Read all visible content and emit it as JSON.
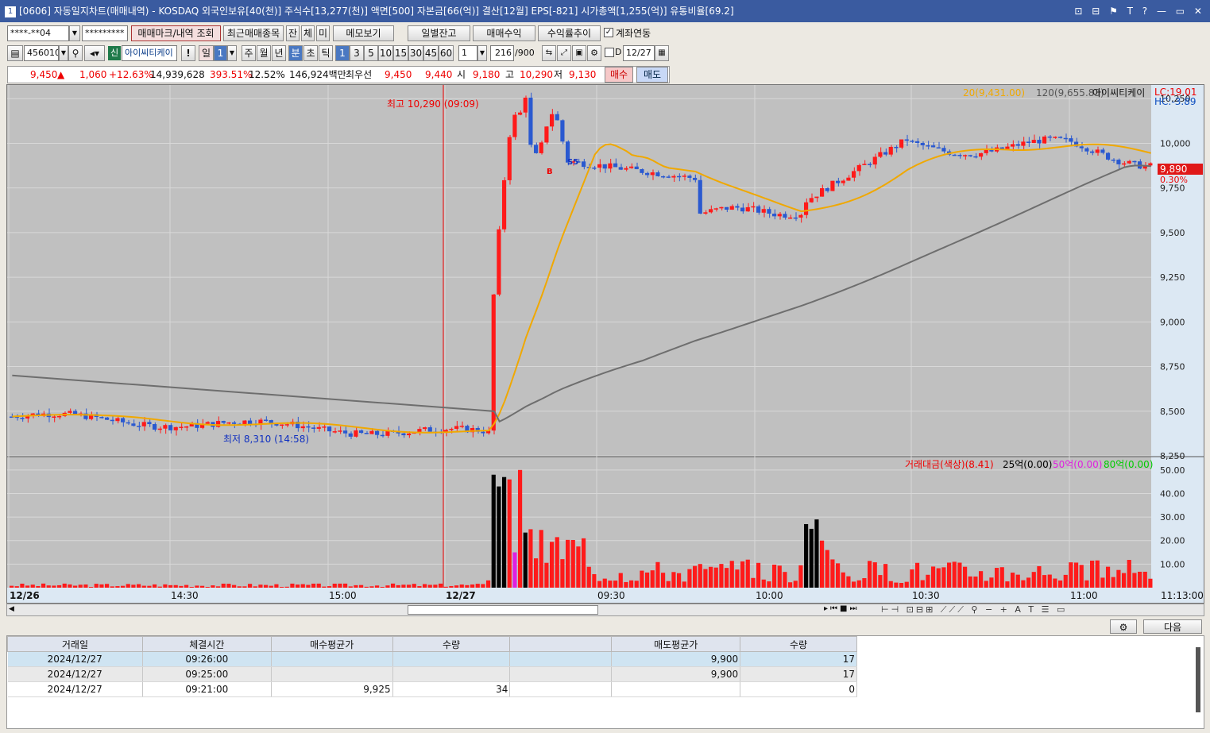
{
  "window": {
    "title": "[0606] 자동일지차트(매매내역) - KOSDAQ 외국인보유[40(천)] 주식수[13,277(천)] 액면[500] 자본금[66(억)] 결산[12월] EPS[-821] 시가총액[1,255(억)] 유통비율[69.2]",
    "number": "1",
    "controls": "⊡ ⊟ ⚑ T ? — ▭ ✕"
  },
  "toolbar1": {
    "account": "****-**04",
    "password": "*********",
    "btn_mark": "매매마크/내역 조회",
    "btn_recent": "최근매매종목",
    "btn_jan": "잔",
    "btn_che": "체",
    "btn_mi": "미",
    "btn_memo": "메모보기",
    "btn_daily": "일별잔고",
    "btn_profit": "매매수익",
    "btn_rate": "수익률추이",
    "chk_link": "계좌연동"
  },
  "toolbar2": {
    "code": "456010",
    "badge": "신",
    "name": "아이씨티케이",
    "excl": "!",
    "day": "일",
    "day_num": "1",
    "week": "주",
    "month": "월",
    "year": "년",
    "minute": "분",
    "second": "초",
    "tick": "틱",
    "periods": [
      "1",
      "3",
      "5",
      "10",
      "15",
      "30",
      "45",
      "60"
    ],
    "period_sel": "1",
    "count": "216",
    "count_max": "/900",
    "d_label": "D",
    "date": "12/27"
  },
  "pricebar": {
    "price": "9,450",
    "arrow": "▲",
    "change": "1,060",
    "change_pct": "+12.63%",
    "volume": "14,939,628",
    "vol_ratio": "393.51%",
    "turnover": "12.52%",
    "amount": "146,924백만",
    "priority_label": "최우선",
    "bid": "9,450",
    "ask": "9,440",
    "open_label": "시",
    "open": "9,180",
    "high_label": "고",
    "high": "10,290",
    "low_label": "저",
    "low": "9,130",
    "buy": "매수",
    "sell": "매도"
  },
  "chart": {
    "legend_ma20": "20(9,431.00)",
    "legend_ma120": "120(9,655.83)",
    "legend_name": "아이씨티케이",
    "lc": "LC:19.01",
    "hc": "HC:-3.89",
    "current_price": "9,890",
    "current_pct": "0.30%",
    "high_note": "최고 10,290 (09:09)",
    "low_note": "최저 8,310 (14:58)",
    "y_ticks": [
      "10,250",
      "10,000",
      "9,750",
      "9,500",
      "9,250",
      "9,000",
      "8,750",
      "8,500",
      "8,250"
    ],
    "vol_legend_main": "거래대금(색상)(8.41)",
    "vol_legend_25": "25억(0.00)",
    "vol_legend_50": "50억(0.00)",
    "vol_legend_80": "80억(0.00)",
    "vol_ticks": [
      "50.00",
      "40.00",
      "30.00",
      "20.00",
      "10.00"
    ],
    "x_labels": [
      "12/26",
      "14:30",
      "15:00",
      "12/27",
      "09:30",
      "10:00",
      "10:30",
      "11:00",
      "11:13:00"
    ],
    "markers": [
      "B",
      "S5"
    ],
    "colors": {
      "up": "#ff1a1a",
      "down": "#2a59d0",
      "ma20": "#f0a800",
      "ma120": "#6e6e6e",
      "vol_mid": "#e020e0",
      "vol_big": "#000000",
      "bg": "#c0c0c0"
    }
  },
  "chart_data": {
    "type": "candlestick",
    "title": "",
    "ylim": [
      8250,
      10300
    ],
    "high": 10290,
    "low": 8310,
    "prev_session_close_approx": 8400,
    "open": 9180,
    "last": 9890
  },
  "grid": {
    "next_btn": "다음",
    "headers": [
      "거래일",
      "체결시간",
      "매수평균가",
      "수량",
      "",
      "매도평균가",
      "수량"
    ],
    "rows": [
      [
        "2024/12/27",
        "09:26:00",
        "",
        "",
        "",
        "9,900",
        "17"
      ],
      [
        "2024/12/27",
        "09:25:00",
        "",
        "",
        "",
        "9,900",
        "17"
      ],
      [
        "2024/12/27",
        "09:21:00",
        "9,925",
        "34",
        "",
        "",
        "0"
      ]
    ]
  }
}
